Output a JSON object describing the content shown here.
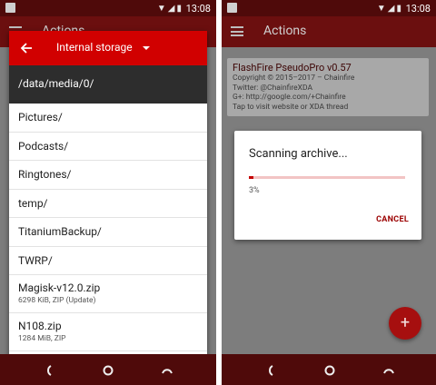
{
  "left": {
    "status": {
      "time": "13:08"
    },
    "appbar": {
      "title": "Actions"
    },
    "picker": {
      "storage_label": "Internal storage",
      "path": "/data/media/0/",
      "folders": [
        "Pictures/",
        "Podcasts/",
        "Ringtones/",
        "temp/",
        "TitaniumBackup/",
        "TWRP/"
      ],
      "files": [
        {
          "name": "Magisk-v12.0.zip",
          "detail": "6298 KiB, ZIP (Update)"
        },
        {
          "name": "N108.zip",
          "detail": "1284 MiB, ZIP"
        }
      ]
    }
  },
  "right": {
    "status": {
      "time": "13:08"
    },
    "appbar": {
      "title": "Actions"
    },
    "info_card": {
      "title": "FlashFire PseudoPro v0.57",
      "lines": [
        "Copyright © 2015–2017 – Chainfire",
        "Twitter: @ChainfireXDA",
        "G+: http://google.com/+Chainfire",
        "Tap to visit website or XDA thread"
      ]
    },
    "scan_dialog": {
      "title": "Scanning archive...",
      "progress_percent": 3,
      "progress_text": "3%",
      "cancel_label": "CANCEL"
    },
    "fab_symbol": "+"
  },
  "colors": {
    "accent_red": "#d10000",
    "appbar_dark_red": "#6b0f0f",
    "statusbar_dark_red": "#4f0a0a"
  },
  "icons": {
    "menu": "hamburger-icon",
    "back": "arrow-back-icon",
    "dropdown": "caret-down-icon",
    "nav_back": "nav-back-icon",
    "nav_home": "nav-home-icon",
    "nav_recent": "nav-recent-icon",
    "add": "plus-icon"
  }
}
